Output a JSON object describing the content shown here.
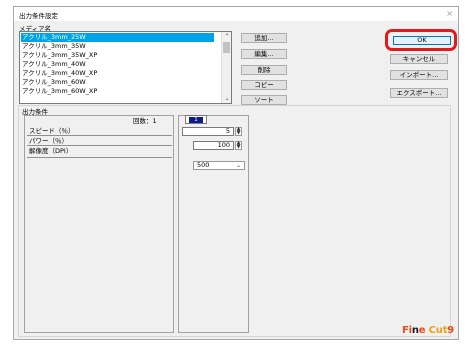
{
  "window": {
    "title": "出力条件設定",
    "close_glyph": "×"
  },
  "media": {
    "label": "メディア名",
    "items": [
      {
        "label": "アクリル_3mm_25W",
        "selected": true
      },
      {
        "label": "アクリル_3mm_35W",
        "selected": false
      },
      {
        "label": "アクリル_3mm_35W_XP",
        "selected": false
      },
      {
        "label": "アクリル_3mm_40W",
        "selected": false
      },
      {
        "label": "アクリル_3mm_40W_XP",
        "selected": false
      },
      {
        "label": "アクリル_3mm_60W",
        "selected": false
      },
      {
        "label": "アクリル_3mm_60W_XP",
        "selected": false
      }
    ],
    "scroll_up_glyph": "⌃",
    "scroll_down_glyph": "⌄"
  },
  "list_buttons": {
    "add": "追加...",
    "edit": "編集...",
    "delete": "削除",
    "copy": "コピー",
    "sort": "ソート"
  },
  "side_buttons": {
    "ok": "OK",
    "cancel": "キャンセル",
    "import": "インポート...",
    "export": "エクスポート..."
  },
  "output": {
    "label": "出力条件",
    "count_label": "回数：1",
    "params": [
      "スピード（％）",
      "パワー（％）",
      "解像度（DPI）"
    ],
    "tab_number": "1",
    "speed_value": "5",
    "power_value": "100",
    "dpi_value": "500",
    "dpi_chevron": "⌄"
  },
  "logo": {
    "part1": "Fi",
    "part2": "n",
    "part3": "e ",
    "part4": "Cut",
    "part5": "9"
  },
  "colors": {
    "selection": "#00a2e8",
    "highlight_ring": "#e31a1a",
    "tab_badge": "#0b1a8c"
  }
}
